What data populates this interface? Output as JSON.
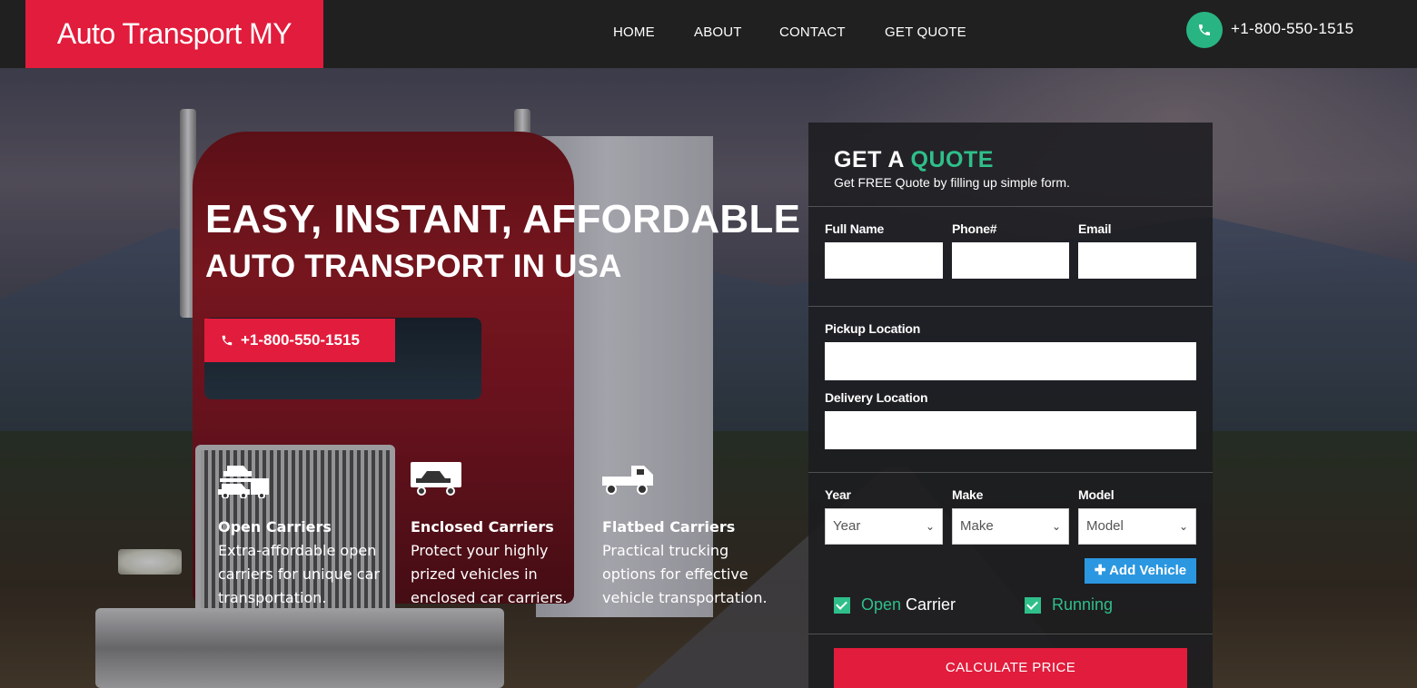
{
  "header": {
    "brand": "Auto Transport MY",
    "nav": [
      "HOME",
      "ABOUT",
      "CONTACT",
      "GET QUOTE"
    ],
    "phone": "+1-800-550-1515",
    "phone_icon": "phone-icon"
  },
  "hero": {
    "headline": "EASY, INSTANT, AFFORDABLE",
    "subheadline": "AUTO TRANSPORT IN USA",
    "cta_phone": "+1-800-550-1515",
    "features": [
      {
        "icon": "car-carrier-icon",
        "title": "Open Carriers",
        "description": "Extra-affordable open carriers for unique car transportation."
      },
      {
        "icon": "enclosed-truck-icon",
        "title": "Enclosed Carriers",
        "description": "Protect your highly prized vehicles in enclosed car carriers."
      },
      {
        "icon": "flatbed-truck-icon",
        "title": "Flatbed Carriers",
        "description": "Practical trucking options for effective vehicle transportation."
      }
    ]
  },
  "quote_form": {
    "title_prefix": "GET A",
    "title_accent": "QUOTE",
    "subtitle": "Get FREE Quote by filling up simple form.",
    "labels": {
      "full_name": "Full Name",
      "phone": "Phone#",
      "email": "Email",
      "pickup": "Pickup Location",
      "delivery": "Delivery Location",
      "year": "Year",
      "make": "Make",
      "model": "Model"
    },
    "values": {
      "full_name": "",
      "phone": "",
      "email": "",
      "pickup": "",
      "delivery": ""
    },
    "selects": {
      "year": "Year",
      "make": "Make",
      "model": "Model"
    },
    "add_vehicle": "Add Vehicle",
    "checkboxes": [
      {
        "green": "Open",
        "white": " Carrier",
        "checked": true
      },
      {
        "green": "Running",
        "white": "",
        "checked": true
      }
    ],
    "submit": "CALCULATE PRICE"
  },
  "colors": {
    "brand_red": "#e21c3c",
    "accent_green": "#2fbf8a",
    "button_blue": "#2b97e0",
    "header_bg": "#202020"
  }
}
